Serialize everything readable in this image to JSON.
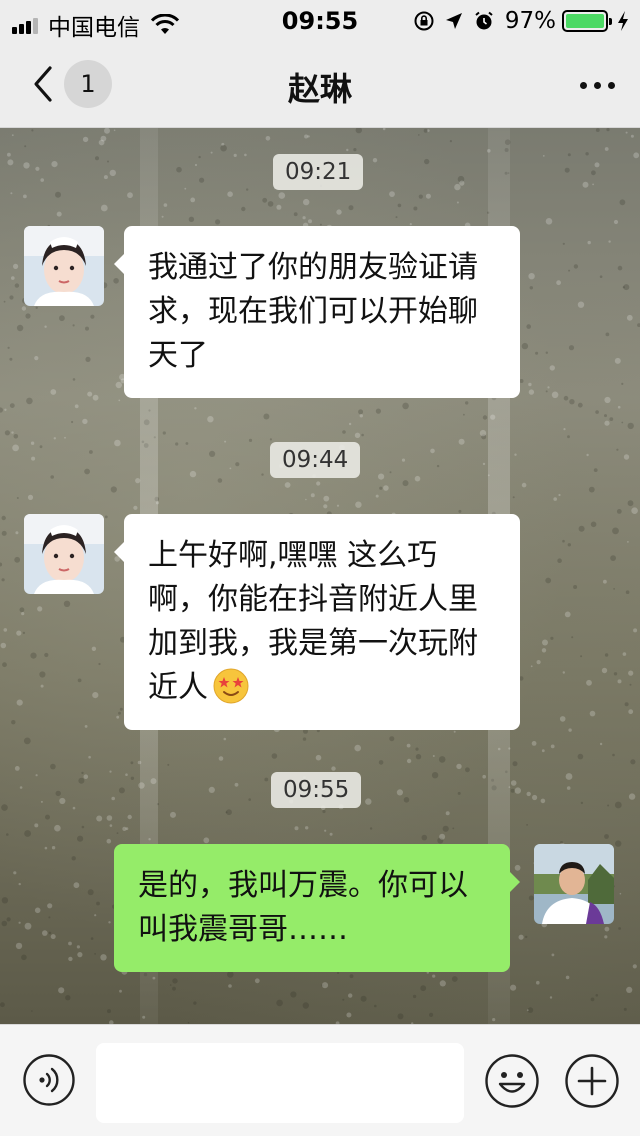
{
  "status_bar": {
    "carrier": "中国电信",
    "time": "09:55",
    "battery_percent": "97%",
    "icons": [
      "signal-icon",
      "wifi-icon",
      "rotation-lock-icon",
      "location-icon",
      "alarm-icon",
      "battery-icon",
      "charging-icon"
    ]
  },
  "nav": {
    "back_icon": "chevron-left-icon",
    "unread_count": "1",
    "title": "赵琳",
    "more_icon": "more-dots-icon"
  },
  "messages": [
    {
      "type": "time",
      "text": "09:21"
    },
    {
      "type": "incoming",
      "text": "我通过了你的朋友验证请求，现在我们可以开始聊天了"
    },
    {
      "type": "time",
      "text": "09:44"
    },
    {
      "type": "incoming",
      "text": "上午好啊,嘿嘿 这么巧啊，你能在抖音附近人里加到我，我是第一次玩附近人",
      "emoji": "star-struck-face"
    },
    {
      "type": "time",
      "text": "09:55"
    },
    {
      "type": "outgoing",
      "text": "是的，我叫万震。你可以叫我震哥哥……"
    }
  ],
  "input_bar": {
    "value": "",
    "icons": [
      "voice-icon",
      "emoji-icon",
      "plus-icon"
    ]
  },
  "colors": {
    "outgoing_bubble": "#95ec69",
    "incoming_bubble": "#ffffff",
    "battery": "#4cd964"
  }
}
